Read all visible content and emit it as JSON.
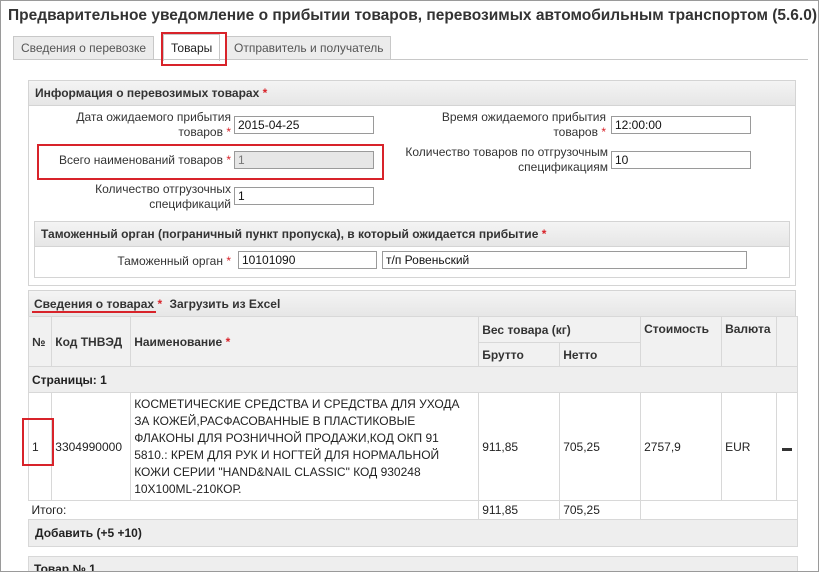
{
  "title": "Предварительное уведомление о прибытии товаров, перевозимых автомобильным транспортом (5.6.0)",
  "tabs": [
    {
      "label": "Сведения о перевозке",
      "active": false
    },
    {
      "label": "Товары",
      "active": true
    },
    {
      "label": "Отправитель и получатель",
      "active": false
    }
  ],
  "info": {
    "header": "Информация о перевозимых товарах",
    "arrival_date": {
      "label": "Дата ожидаемого прибытия товаров",
      "value": "2015-04-25"
    },
    "arrival_time": {
      "label": "Время ожидаемого прибытия товаров",
      "value": "12:00:00"
    },
    "total_names": {
      "label": "Всего наименований товаров",
      "value": "1"
    },
    "goods_count": {
      "label": "Количество товаров по отгрузочным спецификациям",
      "value": "10"
    },
    "spec_count": {
      "label": "Количество отгрузочных спецификаций",
      "value": "1"
    }
  },
  "customs": {
    "header": "Таможенный орган (пограничный пункт пропуска), в который ожидается прибытие",
    "label": "Таможенный орган",
    "code": "10101090",
    "name": "т/п Ровеньский"
  },
  "goods": {
    "header": "Сведения о товарах",
    "load_excel": "Загрузить из Excel",
    "columns": {
      "num": "№",
      "code": "Код ТНВЭД",
      "name": "Наименование",
      "weight": "Вес товара (кг)",
      "gross": "Брутто",
      "net": "Нетто",
      "cost": "Стоимость",
      "currency": "Валюта"
    },
    "pages": "Страницы: 1",
    "rows": [
      {
        "num": "1",
        "code": "3304990000",
        "name": "КОСМЕТИЧЕСКИЕ СРЕДСТВА И СРЕДСТВА ДЛЯ УХОДА ЗА КОЖЕЙ,РАСФАСОВАННЫЕ В ПЛАСТИКОВЫЕ ФЛАКОНЫ ДЛЯ РОЗНИЧНОЙ ПРОДАЖИ,КОД ОКП 91 5810.: КРЕМ ДЛЯ РУК И НОГТЕЙ ДЛЯ НОРМАЛЬНОЙ КОЖИ СЕРИИ \"HAND&NAIL CLASSIC\" КОД 930248 10X100ML-210КОР.",
        "gross": "911,85",
        "net": "705,25",
        "cost": "2757,9",
        "currency": "EUR"
      }
    ],
    "total": {
      "label": "Итого:",
      "gross": "911,85",
      "net": "705,25"
    },
    "add_label": "Добавить",
    "add_5": "(+5",
    "add_10": "+10)",
    "item_header": "Товар № 1"
  }
}
